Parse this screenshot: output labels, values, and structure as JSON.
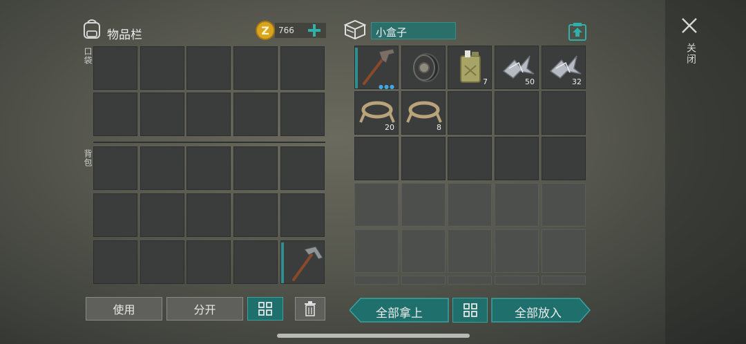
{
  "inventory": {
    "title": "物品栏",
    "coins": "766",
    "pocket_label": "口袋",
    "backpack_label": "背包"
  },
  "container": {
    "name": "小盒子",
    "items": [
      {
        "name": "pickaxe",
        "count": ""
      },
      {
        "name": "wheel",
        "count": ""
      },
      {
        "name": "gas-can",
        "count": "7"
      },
      {
        "name": "metal-scrap",
        "count": "50"
      },
      {
        "name": "metal-scrap",
        "count": "32"
      },
      {
        "name": "rope",
        "count": "20"
      },
      {
        "name": "rope",
        "count": "8"
      }
    ]
  },
  "buttons": {
    "use": "使用",
    "split": "分开",
    "take_all": "全部拿上",
    "put_all": "全部放入"
  },
  "close_label": "关闭",
  "colors": {
    "accent_teal": "#2f8e8e",
    "coin_gold": "#d9a520"
  }
}
